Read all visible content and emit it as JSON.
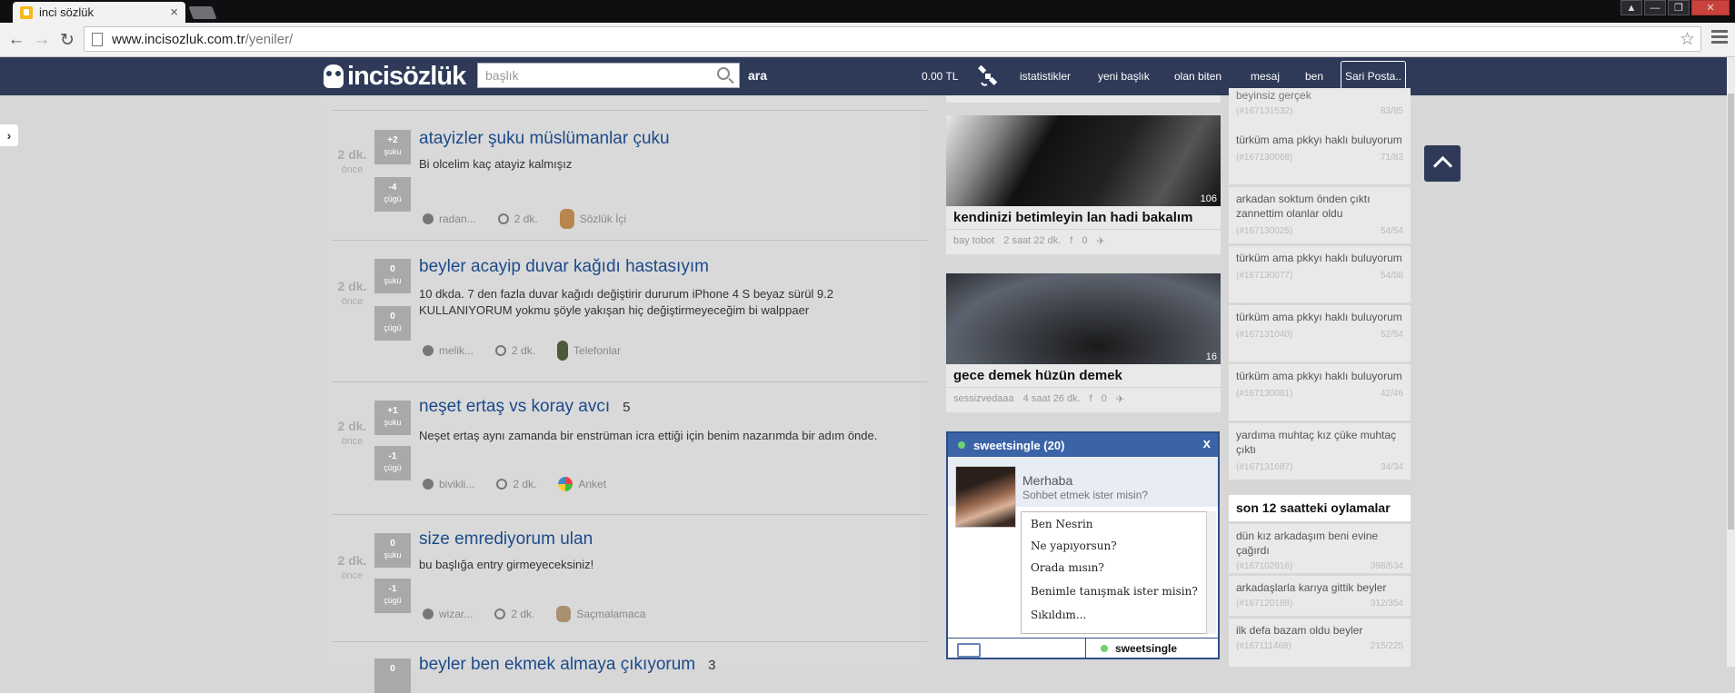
{
  "browser": {
    "tab_title": "inci sözlük",
    "url_host": "www.incisozluk.com.tr",
    "url_path": "/yeniler/"
  },
  "site": {
    "logo": "incisözlük",
    "search_placeholder": "başlık",
    "search_button": "ara",
    "nav": [
      "0.00 TL",
      "istatistikler",
      "yeni başlık",
      "olan biten",
      "mesaj",
      "ben"
    ],
    "post_button": "Sari Posta.."
  },
  "entries": [
    {
      "time": "2 dk.",
      "time_sub": "önce",
      "up": "+2",
      "up_label": "şuku",
      "down": "-4",
      "down_label": "çügü",
      "title": "atayizler şuku müslümanlar çuku",
      "count": "",
      "text": "Bi olcelim kaç atayiz kalmışız",
      "author": "radan...",
      "ago": "2 dk.",
      "category": "Sözlük İçi"
    },
    {
      "time": "2 dk.",
      "time_sub": "önce",
      "up": "0",
      "up_label": "şuku",
      "down": "0",
      "down_label": "çügü",
      "title": "beyler acayip duvar kağıdı hastasıyım",
      "count": "",
      "text": "10 dkda. 7 den fazla duvar kağıdı değiştirir dururum iPhone 4 S beyaz sürül 9.2 KULLANIYORUM yokmu şöyle yakışan hiç değiştirmeyeceğim bi walppaer",
      "author": "melik...",
      "ago": "2 dk.",
      "category": "Telefonlar"
    },
    {
      "time": "2 dk.",
      "time_sub": "önce",
      "up": "+1",
      "up_label": "şuku",
      "down": "-1",
      "down_label": "çügü",
      "title": "neşet ertaş vs koray avcı",
      "count": "5",
      "text": "Neşet ertaş aynı zamanda bir enstrüman icra ettiği için benim nazarımda bir adım önde.",
      "author": "bivikli...",
      "ago": "2 dk.",
      "category": "Anket"
    },
    {
      "time": "2 dk.",
      "time_sub": "önce",
      "up": "0",
      "up_label": "şuku",
      "down": "-1",
      "down_label": "çügü",
      "title": "size emrediyorum ulan",
      "count": "",
      "text": "bu başlığa entry girmeyeceksiniz!",
      "author": "wizar...",
      "ago": "2 dk.",
      "category": "Saçmalamaca"
    },
    {
      "time": "",
      "time_sub": "",
      "up": "0",
      "up_label": "",
      "down": "",
      "down_label": "",
      "title": "beyler ben ekmek almaya çıkıyorum",
      "count": "3",
      "text": "",
      "author": "",
      "ago": "",
      "category": ""
    }
  ],
  "cards": [
    {
      "num": "106",
      "title": "kendinizi betimleyin lan hadi bakalım",
      "author": "bay tobot",
      "ago": "2 saat 22 dk.",
      "likes": "0"
    },
    {
      "num": "16",
      "title": "gece demek hüzün demek",
      "author": "sessizvedaaa",
      "ago": "4 saat 26 dk.",
      "likes": "0"
    }
  ],
  "chat": {
    "title": "sweetsingle (20)",
    "close": "x",
    "greeting": "Merhaba",
    "subtitle": "Sohbet etmek ister misin?",
    "messages": [
      "Ben Nesrin",
      "Ne yapıyorsun?",
      "Orada mısın?",
      "Benimle tanışmak ister misin?",
      "Sıkıldım..."
    ],
    "footer_user": "sweetsingle"
  },
  "right_list": [
    {
      "text": "beyinsiz gerçek",
      "id": "(#167131532)",
      "score": "83/85"
    },
    {
      "text": "türküm ama pkkyı haklı buluyorum",
      "id": "(#167130068)",
      "score": "71/83"
    },
    {
      "text": "arkadan soktum önden çıktı zannettim olanlar oldu",
      "id": "(#167130025)",
      "score": "54/54"
    },
    {
      "text": "türküm ama pkkyı haklı buluyorum",
      "id": "(#167130077)",
      "score": "54/58"
    },
    {
      "text": "türküm ama pkkyı haklı buluyorum",
      "id": "(#167131040)",
      "score": "52/54"
    },
    {
      "text": "türküm ama pkkyı haklı buluyorum",
      "id": "(#167130081)",
      "score": "42/46"
    },
    {
      "text": "yardıma muhtaç kız çüke muhtaç çıktı",
      "id": "(#167131687)",
      "score": "34/34"
    }
  ],
  "right_section_title": "son 12 saatteki oylamalar",
  "right_list2": [
    {
      "text": "dün kız arkadaşım beni evine çağırdı",
      "id": "(#167102916)",
      "score": "398/534"
    },
    {
      "text": "arkadaşlarla karıya gittik beyler",
      "id": "(#167120188)",
      "score": "312/354"
    },
    {
      "text": "ilk defa bazam oldu beyler",
      "id": "(#167111468)",
      "score": "215/225"
    }
  ]
}
